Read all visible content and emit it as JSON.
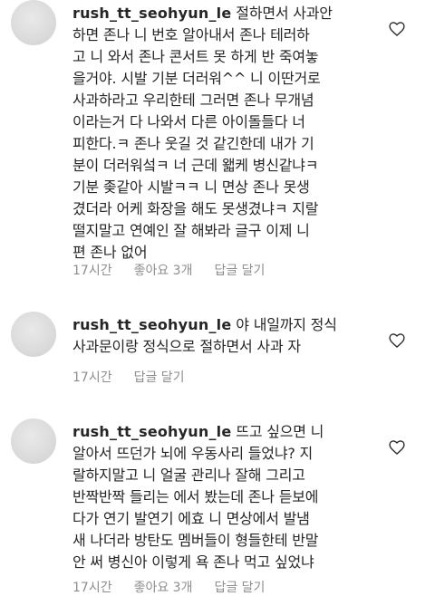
{
  "comments": [
    {
      "username": "rush_tt_seohyun_le",
      "lines": [
        "절하면서 사과안",
        "하면 존나 니 번호 알아내서 존나 테러하",
        "고 니 와서 존나 콘서트 못 하게 반 죽여놓",
        "을거야. 시발 기분 더러워^^ 니 이딴거로",
        "사과하라고 우리한테 그러면 존나 무개념",
        "이라는거 다 나와서 다른 아이돌들다 너",
        "피한다.ㅋ 존나 웃길 것 같긴한데 내가 기",
        "분이 더러워섴ㅋ 너 근데 왧케 병신같냐ㅋ",
        "기분 좆같아 시발ㅋㅋ 니 면상 존나 못생",
        "겼더라 어케 화장을 해도 못생겼냐ㅋ 지랄",
        "떨지말고 연예인 잘 해봐라 글구 이제 니",
        "편 존나 없어"
      ],
      "time": "17시간",
      "likes": "좋아요 3개",
      "reply": "답글 달기"
    },
    {
      "username": "rush_tt_seohyun_le",
      "lines": [
        "야 내일까지 정식",
        "사과문이랑 정식으로 절하면서 사과 자"
      ],
      "time": "17시간",
      "likes": "",
      "reply": "답글 달기"
    },
    {
      "username": "rush_tt_seohyun_le",
      "lines": [
        "뜨고 싶으면 니",
        "알아서 뜨던가 뇌에 우동사리 들었냐? 지",
        "랄하지말고 니 얼굴 관리나 잘해 그리고",
        "반짝반짝 들리는 에서 봤는데 존나 듣보에",
        "다가 연기 발연기 에효 니 면상에서 발냄",
        "새 나더라 방탄도 멤버들이 형들한테 반말",
        "안 써 병신아 이렇게 욕 존나 먹고 싶었냐"
      ],
      "time": "17시간",
      "likes": "좋아요 3개",
      "reply": "답글 달기"
    }
  ],
  "icons": {
    "like": "heart-outline-icon"
  }
}
